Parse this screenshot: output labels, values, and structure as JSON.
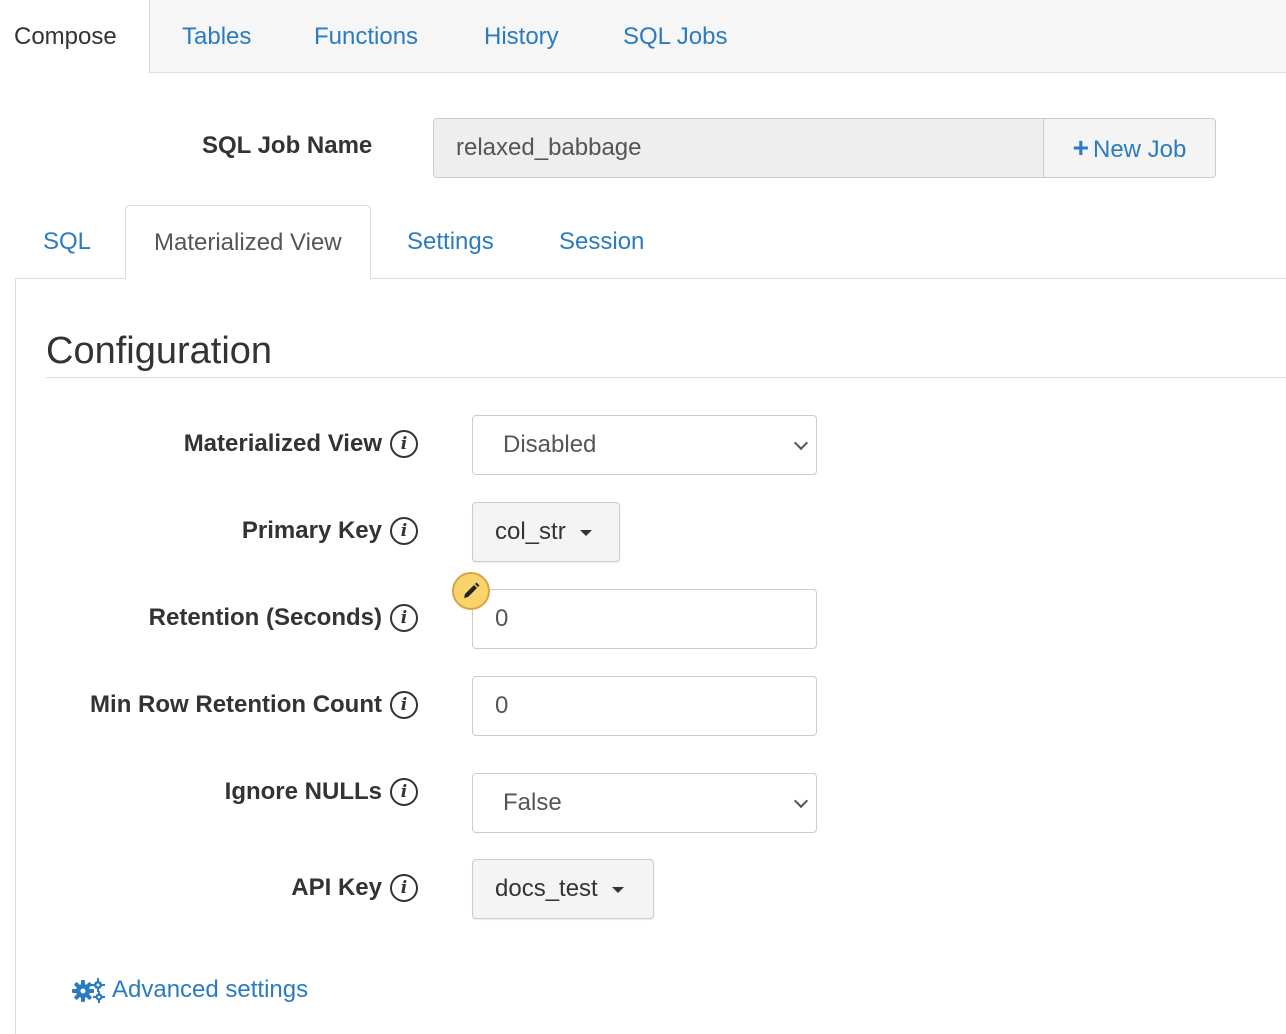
{
  "top_nav": {
    "tabs": [
      {
        "label": "Compose",
        "active": true
      },
      {
        "label": "Tables",
        "active": false
      },
      {
        "label": "Functions",
        "active": false
      },
      {
        "label": "History",
        "active": false
      },
      {
        "label": "SQL Jobs",
        "active": false
      }
    ]
  },
  "job": {
    "label": "SQL Job Name",
    "name_value": "relaxed_babbage",
    "new_job_label": "New Job",
    "new_job_icon": "plus-icon"
  },
  "sub_nav": {
    "tabs": [
      {
        "label": "SQL",
        "active": false
      },
      {
        "label": "Materialized View",
        "active": true
      },
      {
        "label": "Settings",
        "active": false
      },
      {
        "label": "Session",
        "active": false
      }
    ]
  },
  "configuration": {
    "title": "Configuration",
    "fields": {
      "materialized_view": {
        "label": "Materialized View",
        "value": "Disabled"
      },
      "primary_key": {
        "label": "Primary Key",
        "value": "col_str"
      },
      "retention": {
        "label": "Retention (Seconds)",
        "value": "0"
      },
      "min_row_retention": {
        "label": "Min Row Retention Count",
        "value": "0"
      },
      "ignore_nulls": {
        "label": "Ignore NULLs",
        "value": "False"
      },
      "api_key": {
        "label": "API Key",
        "value": "docs_test"
      }
    },
    "info_icon_glyph": "i",
    "advanced_settings_label": "Advanced settings",
    "advanced_settings_icon": "gears-icon"
  },
  "colors": {
    "link": "#2a7bc0",
    "text": "#333333",
    "border": "#dddddd",
    "pencil_badge": "#f9d46a"
  }
}
